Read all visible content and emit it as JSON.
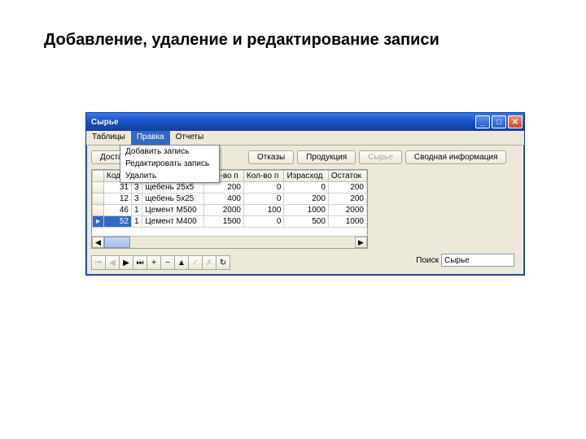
{
  "slide": {
    "title": "Добавление, удаление и редактирование записи"
  },
  "window": {
    "title": "Сырье",
    "menubar": [
      "Таблицы",
      "Правка",
      "Отчеты"
    ],
    "active_menu_index": 1,
    "dropdown": {
      "items": [
        "Добавить запись",
        "Редактировать запись",
        "Удалить"
      ]
    },
    "toolbar": {
      "buttons": [
        {
          "label": "Доставка",
          "disabled": false
        },
        {
          "label": "",
          "disabled": false,
          "hidden": true
        },
        {
          "label": "Отказы",
          "disabled": false
        },
        {
          "label": "Продукция",
          "disabled": false
        },
        {
          "label": "Сырье",
          "disabled": true
        },
        {
          "label": "Сводная информация",
          "disabled": false
        }
      ]
    },
    "grid": {
      "headers": [
        "Код с",
        "",
        "",
        "Кол-во п",
        "Кол-во п",
        "Израсход",
        "Остаток"
      ],
      "rows": [
        {
          "marker": "",
          "cells": [
            "31",
            "3",
            "щебень 25x5",
            "200",
            "0",
            "0",
            "200"
          ]
        },
        {
          "marker": "",
          "cells": [
            "12",
            "3",
            "щебень 5x25",
            "400",
            "0",
            "200",
            "200"
          ]
        },
        {
          "marker": "",
          "cells": [
            "46",
            "1",
            "Цемент M500",
            "2000",
            "100",
            "1000",
            "2000"
          ]
        },
        {
          "marker": "▸",
          "selected": true,
          "cells": [
            "52",
            "1",
            "Цемент M400",
            "1500",
            "0",
            "500",
            "1000"
          ]
        }
      ]
    },
    "navbar_glyphs": [
      "⏮",
      "◀",
      "▶",
      "⏭",
      "+",
      "−",
      "▲",
      "✓",
      "✗",
      "↻"
    ],
    "search": {
      "label": "Поиск",
      "value": "Сырье"
    }
  }
}
